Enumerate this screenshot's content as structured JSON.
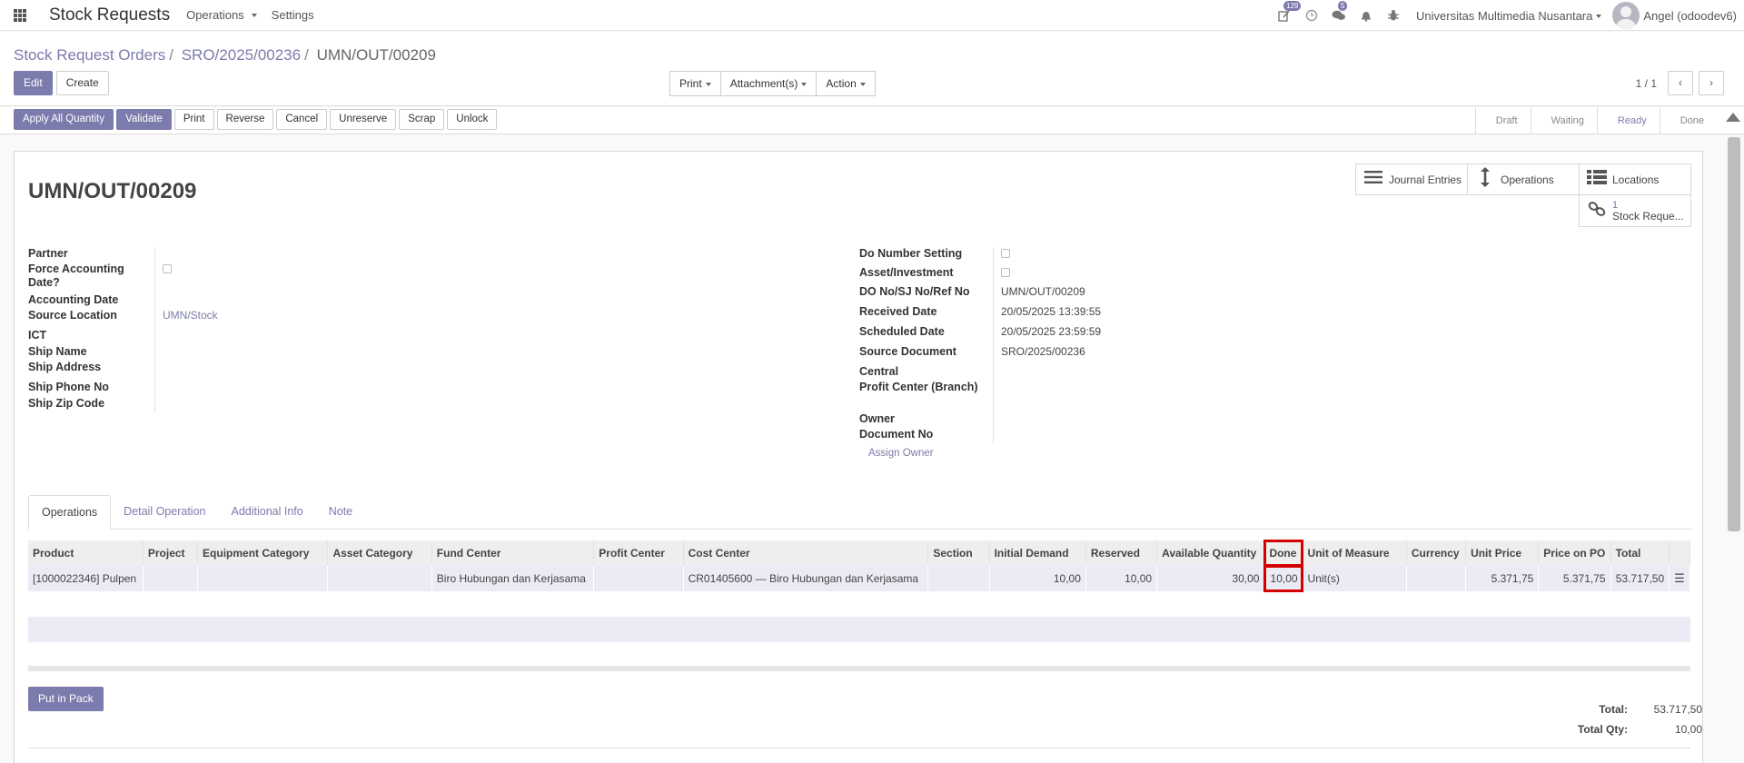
{
  "navbar": {
    "brand": "Stock Requests",
    "menus": [
      {
        "label": "Operations"
      },
      {
        "label": "Settings"
      }
    ],
    "activity_badge": "129",
    "chat_badge": "5",
    "company": "Universitas Multimedia Nusantara",
    "user": "Angel (odoodev6)"
  },
  "breadcrumb": {
    "root": "Stock Request Orders",
    "parent": "SRO/2025/00236",
    "current": "UMN/OUT/00209"
  },
  "control": {
    "edit": "Edit",
    "create": "Create",
    "print": "Print",
    "attachments": "Attachment(s)",
    "action": "Action",
    "pager": "1 / 1"
  },
  "status_buttons": {
    "apply_all": "Apply All Quantity",
    "validate": "Validate",
    "print": "Print",
    "reverse": "Reverse",
    "cancel": "Cancel",
    "unreserve": "Unreserve",
    "scrap": "Scrap",
    "unlock": "Unlock"
  },
  "stages": [
    {
      "label": "Draft",
      "active": false
    },
    {
      "label": "Waiting",
      "active": false
    },
    {
      "label": "Ready",
      "active": true
    },
    {
      "label": "Done",
      "active": false
    }
  ],
  "record": {
    "title": "UMN/OUT/00209"
  },
  "smart_buttons": {
    "journal_entries": "Journal Entries",
    "operations": "Operations",
    "locations": "Locations",
    "stock_count": "1",
    "stock_label": "Stock Reque..."
  },
  "fields_left": {
    "partner": "Partner",
    "force_accounting": "Force Accounting Date?",
    "accounting_date": "Accounting Date",
    "source_location": "Source Location",
    "source_location_value": "UMN/Stock",
    "ict": "ICT",
    "ship_name": "Ship Name",
    "ship_address": "Ship Address",
    "ship_phone": "Ship Phone No",
    "ship_zip": "Ship Zip Code"
  },
  "fields_right": {
    "do_number_setting": "Do Number Setting",
    "asset_investment": "Asset/Investment",
    "do_no": "DO No/SJ No/Ref No",
    "do_no_value": "UMN/OUT/00209",
    "received_date": "Received Date",
    "received_date_value": "20/05/2025 13:39:55",
    "scheduled_date": "Scheduled Date",
    "scheduled_date_value": "20/05/2025 23:59:59",
    "source_document": "Source Document",
    "source_document_value": "SRO/2025/00236",
    "central": "Central",
    "profit_center": "Profit Center (Branch)",
    "owner": "Owner",
    "document_no": "Document No",
    "assign_owner": "Assign Owner"
  },
  "tabs": [
    {
      "label": "Operations",
      "active": true
    },
    {
      "label": "Detail Operation",
      "active": false
    },
    {
      "label": "Additional Info",
      "active": false
    },
    {
      "label": "Note",
      "active": false
    }
  ],
  "table": {
    "headers": {
      "product": "Product",
      "project": "Project",
      "equipment_category": "Equipment Category",
      "asset_category": "Asset Category",
      "fund_center": "Fund Center",
      "profit_center": "Profit Center",
      "cost_center": "Cost Center",
      "section": "Section",
      "initial_demand": "Initial Demand",
      "reserved": "Reserved",
      "available_quantity": "Available Quantity",
      "done": "Done",
      "uom": "Unit of Measure",
      "currency": "Currency",
      "unit_price": "Unit Price",
      "price_on_po": "Price on PO",
      "total": "Total"
    },
    "rows": [
      {
        "product": "[1000022346] Pulpen",
        "project": "",
        "equipment_category": "",
        "asset_category": "",
        "fund_center": "Biro Hubungan dan Kerjasama",
        "profit_center": "",
        "cost_center": "CR01405600 — Biro Hubungan dan Kerjasama",
        "section": "",
        "initial_demand": "10,00",
        "reserved": "10,00",
        "available_quantity": "30,00",
        "done": "10,00",
        "uom": "Unit(s)",
        "currency": "",
        "unit_price": "5.371,75",
        "price_on_po": "5.371,75",
        "total": "53.717,50"
      }
    ]
  },
  "footer": {
    "put_in_pack": "Put in Pack",
    "total_label": "Total:",
    "total_value": "53.717,50",
    "total_qty_label": "Total Qty:",
    "total_qty_value": "10,00"
  },
  "colors": {
    "primary": "#7c7bad",
    "highlight": "#d40000"
  }
}
